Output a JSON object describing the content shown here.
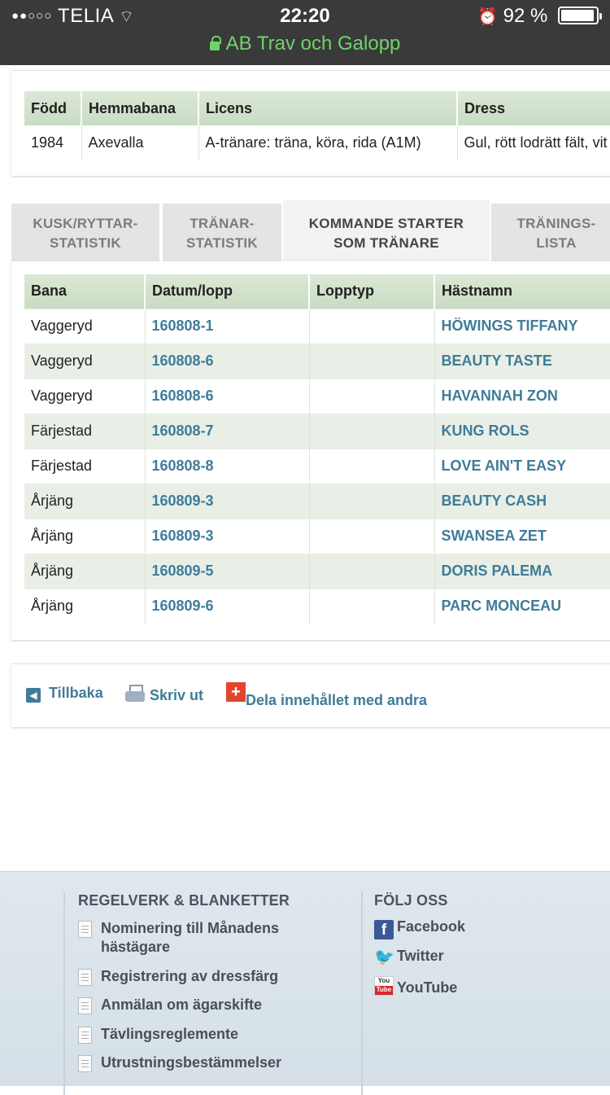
{
  "status_bar": {
    "carrier": "TELIA",
    "time": "22:20",
    "battery": "92 %",
    "url": "AB Trav och Galopp"
  },
  "info_table": {
    "headers": [
      "Född",
      "Hemmabana",
      "Licens",
      "Dress"
    ],
    "row": [
      "1984",
      "Axevalla",
      "A-tränare: träna, köra, rida (A1M)",
      "Gul, rött lodrätt fält, vit"
    ]
  },
  "tabs": [
    {
      "line1": "KUSK/RYTTAR-",
      "line2": "STATISTIK"
    },
    {
      "line1": "TRÄNAR-",
      "line2": "STATISTIK"
    },
    {
      "line1": "KOMMANDE STARTER",
      "line2": "SOM TRÄNARE"
    },
    {
      "line1": "TRÄNINGS-",
      "line2": "LISTA"
    }
  ],
  "starts_table": {
    "headers": [
      "Bana",
      "Datum/lopp",
      "Lopptyp",
      "Hästnamn"
    ],
    "rows": [
      [
        "Vaggeryd",
        "160808-1",
        "",
        "HÖWINGS TIFFANY"
      ],
      [
        "Vaggeryd",
        "160808-6",
        "",
        "BEAUTY TASTE"
      ],
      [
        "Vaggeryd",
        "160808-6",
        "",
        "HAVANNAH ZON"
      ],
      [
        "Färjestad",
        "160808-7",
        "",
        "KUNG ROLS"
      ],
      [
        "Färjestad",
        "160808-8",
        "",
        "LOVE AIN'T EASY"
      ],
      [
        "Årjäng",
        "160809-3",
        "",
        "BEAUTY CASH"
      ],
      [
        "Årjäng",
        "160809-3",
        "",
        "SWANSEA ZET"
      ],
      [
        "Årjäng",
        "160809-5",
        "",
        "DORIS PALEMA"
      ],
      [
        "Årjäng",
        "160809-6",
        "",
        "PARC MONCEAU"
      ]
    ]
  },
  "actions": {
    "back": "Tillbaka",
    "print": "Skriv ut",
    "share": "Dela innehållet med andra"
  },
  "footer": {
    "rules_heading": "REGELVERK & BLANKETTER",
    "rules_links": [
      "Nominering till Månadens hästägare",
      "Registrering av dressfärg",
      "Anmälan om ägarskifte",
      "Tävlingsreglemente",
      "Utrustningsbestämmelser"
    ],
    "follow_heading": "FÖLJ OSS",
    "social": [
      "Facebook",
      "Twitter",
      "YouTube"
    ]
  },
  "colors": {
    "link": "#3f7c99",
    "header_green": "#d1e1cc",
    "row_alt": "#e9efe6",
    "url_green": "#6fd36b"
  }
}
